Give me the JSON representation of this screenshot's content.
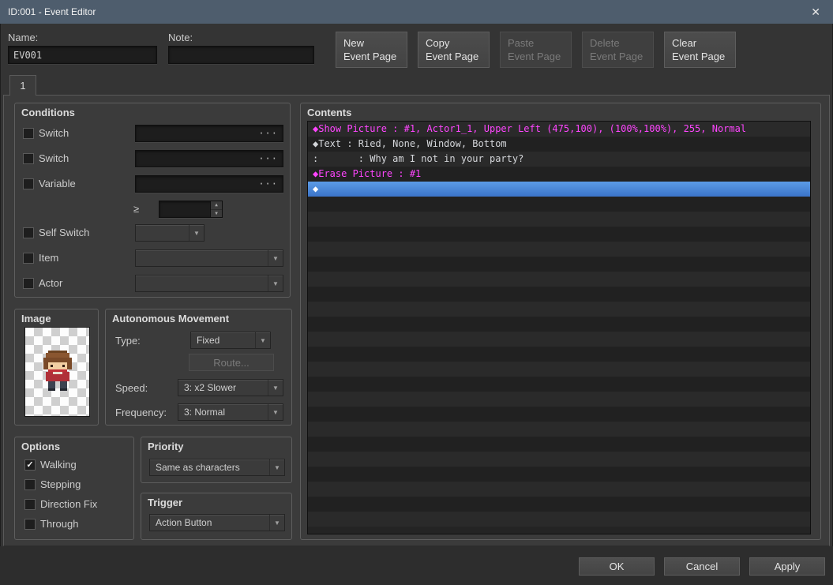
{
  "titlebar": {
    "title": "ID:001 - Event Editor"
  },
  "icons": {
    "close": "✕",
    "more": "···",
    "dropdown": "▼",
    "spin_up": "▲",
    "spin_down": "▼",
    "check": "✓"
  },
  "header": {
    "name_label": "Name:",
    "name_value": "EV001",
    "note_label": "Note:",
    "note_value": "",
    "page_buttons": [
      {
        "label_line1": "New",
        "label_line2": "Event Page",
        "disabled": false
      },
      {
        "label_line1": "Copy",
        "label_line2": "Event Page",
        "disabled": false
      },
      {
        "label_line1": "Paste",
        "label_line2": "Event Page",
        "disabled": true
      },
      {
        "label_line1": "Delete",
        "label_line2": "Event Page",
        "disabled": true
      },
      {
        "label_line1": "Clear",
        "label_line2": "Event Page",
        "disabled": false
      }
    ]
  },
  "tab": {
    "label": "1"
  },
  "conditions": {
    "title": "Conditions",
    "switch1": {
      "label": "Switch",
      "value": ""
    },
    "switch2": {
      "label": "Switch",
      "value": ""
    },
    "variable": {
      "label": "Variable",
      "value": ""
    },
    "gte": {
      "symbol": "≥",
      "value": ""
    },
    "self_switch": {
      "label": "Self Switch",
      "value": ""
    },
    "item": {
      "label": "Item",
      "value": ""
    },
    "actor": {
      "label": "Actor",
      "value": ""
    }
  },
  "image": {
    "title": "Image"
  },
  "movement": {
    "title": "Autonomous Movement",
    "type_label": "Type:",
    "type_value": "Fixed",
    "route_label": "Route...",
    "speed_label": "Speed:",
    "speed_value": "3: x2 Slower",
    "frequency_label": "Frequency:",
    "frequency_value": "3: Normal"
  },
  "options": {
    "title": "Options",
    "items": [
      {
        "label": "Walking",
        "checked": true
      },
      {
        "label": "Stepping",
        "checked": false
      },
      {
        "label": "Direction Fix",
        "checked": false
      },
      {
        "label": "Through",
        "checked": false
      }
    ]
  },
  "priority": {
    "title": "Priority",
    "value": "Same as characters"
  },
  "trigger": {
    "title": "Trigger",
    "value": "Action Button"
  },
  "contents": {
    "title": "Contents",
    "rows": [
      {
        "text": "◆Show Picture : #1, Actor1_1, Upper Left (475,100), (100%,100%), 255, Normal",
        "type": "picture"
      },
      {
        "text": "◆Text : Ried, None, Window, Bottom",
        "type": "text"
      },
      {
        "text": ":       : Why am I not in your party?",
        "type": "text"
      },
      {
        "text": "◆Erase Picture : #1",
        "type": "picture"
      },
      {
        "text": "◆",
        "type": "selected"
      }
    ],
    "empty_row_count": 22
  },
  "footer": {
    "ok": "OK",
    "cancel": "Cancel",
    "apply": "Apply"
  },
  "colors": {
    "titlebar": "#4e5d6d",
    "selection": "#4b8ce0",
    "command_picture": "#ff45ff",
    "command_text": "#d4d6da"
  }
}
